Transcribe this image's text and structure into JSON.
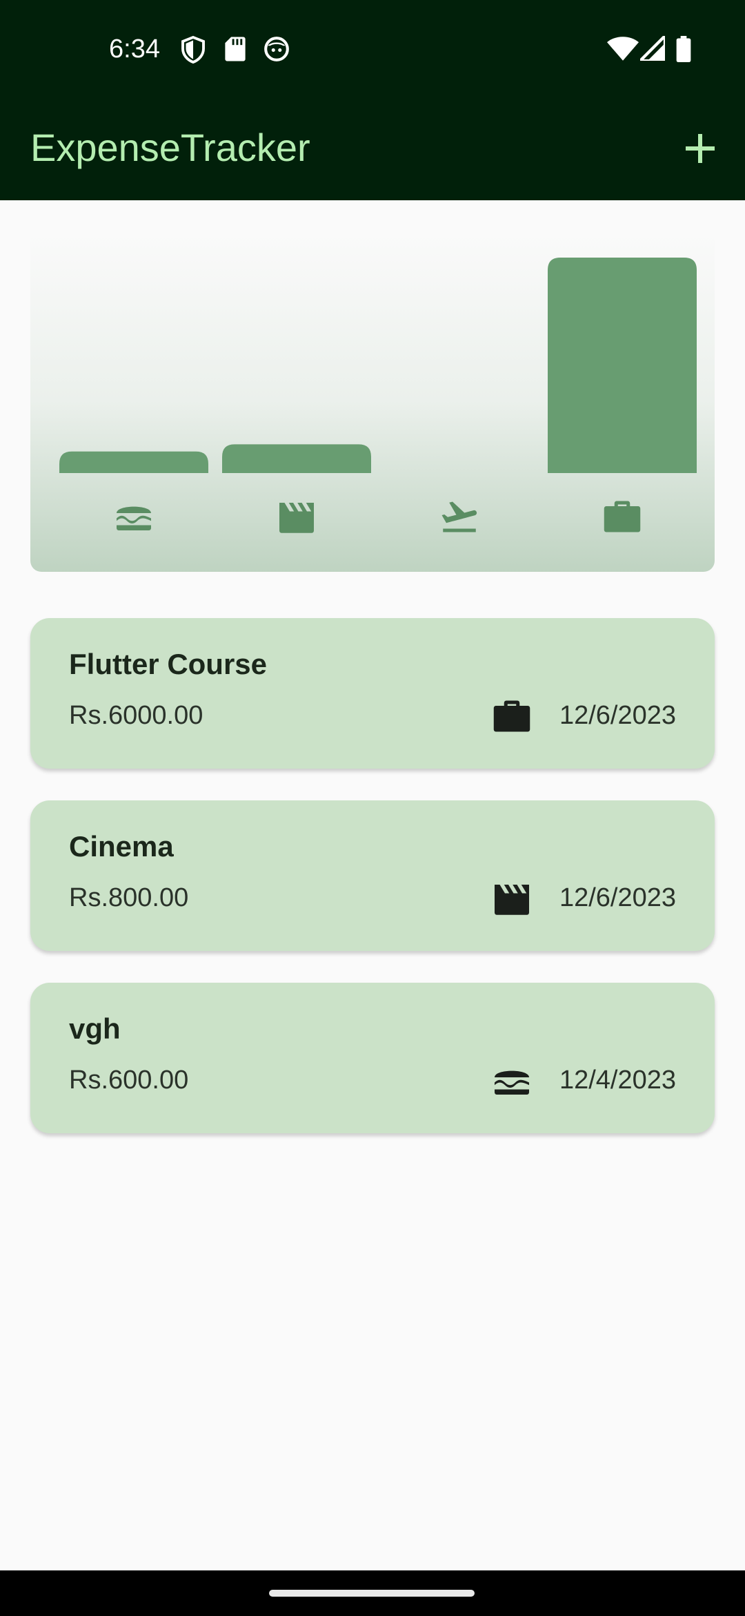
{
  "status_bar": {
    "time": "6:34",
    "left_icons": [
      "shield-icon",
      "sd-card-icon",
      "face-icon"
    ],
    "right_icons": [
      "wifi-icon",
      "cell-signal-icon",
      "battery-icon"
    ]
  },
  "app_bar": {
    "title": "ExpenseTracker",
    "add_icon": "plus-icon"
  },
  "colors": {
    "app_bar_bg": "#01200a",
    "title": "#b4edb0",
    "bar": "#689d71",
    "card_bg": "#cbe2c8",
    "icon": "#5a8d62"
  },
  "chart_data": {
    "type": "bar",
    "categories": [
      "food",
      "leisure",
      "travel",
      "work"
    ],
    "category_icons": [
      "burger-icon",
      "movie-clapper-icon",
      "flight-takeoff-icon",
      "briefcase-icon"
    ],
    "values": [
      600,
      800,
      0,
      6000
    ],
    "ylim": [
      0,
      6000
    ],
    "title": "",
    "xlabel": "",
    "ylabel": ""
  },
  "expenses": [
    {
      "title": "Flutter Course",
      "amount": "Rs.6000.00",
      "category_icon": "briefcase-icon",
      "date": "12/6/2023"
    },
    {
      "title": "Cinema",
      "amount": "Rs.800.00",
      "category_icon": "movie-clapper-icon",
      "date": "12/6/2023"
    },
    {
      "title": "vgh",
      "amount": "Rs.600.00",
      "category_icon": "burger-icon",
      "date": "12/4/2023"
    }
  ]
}
